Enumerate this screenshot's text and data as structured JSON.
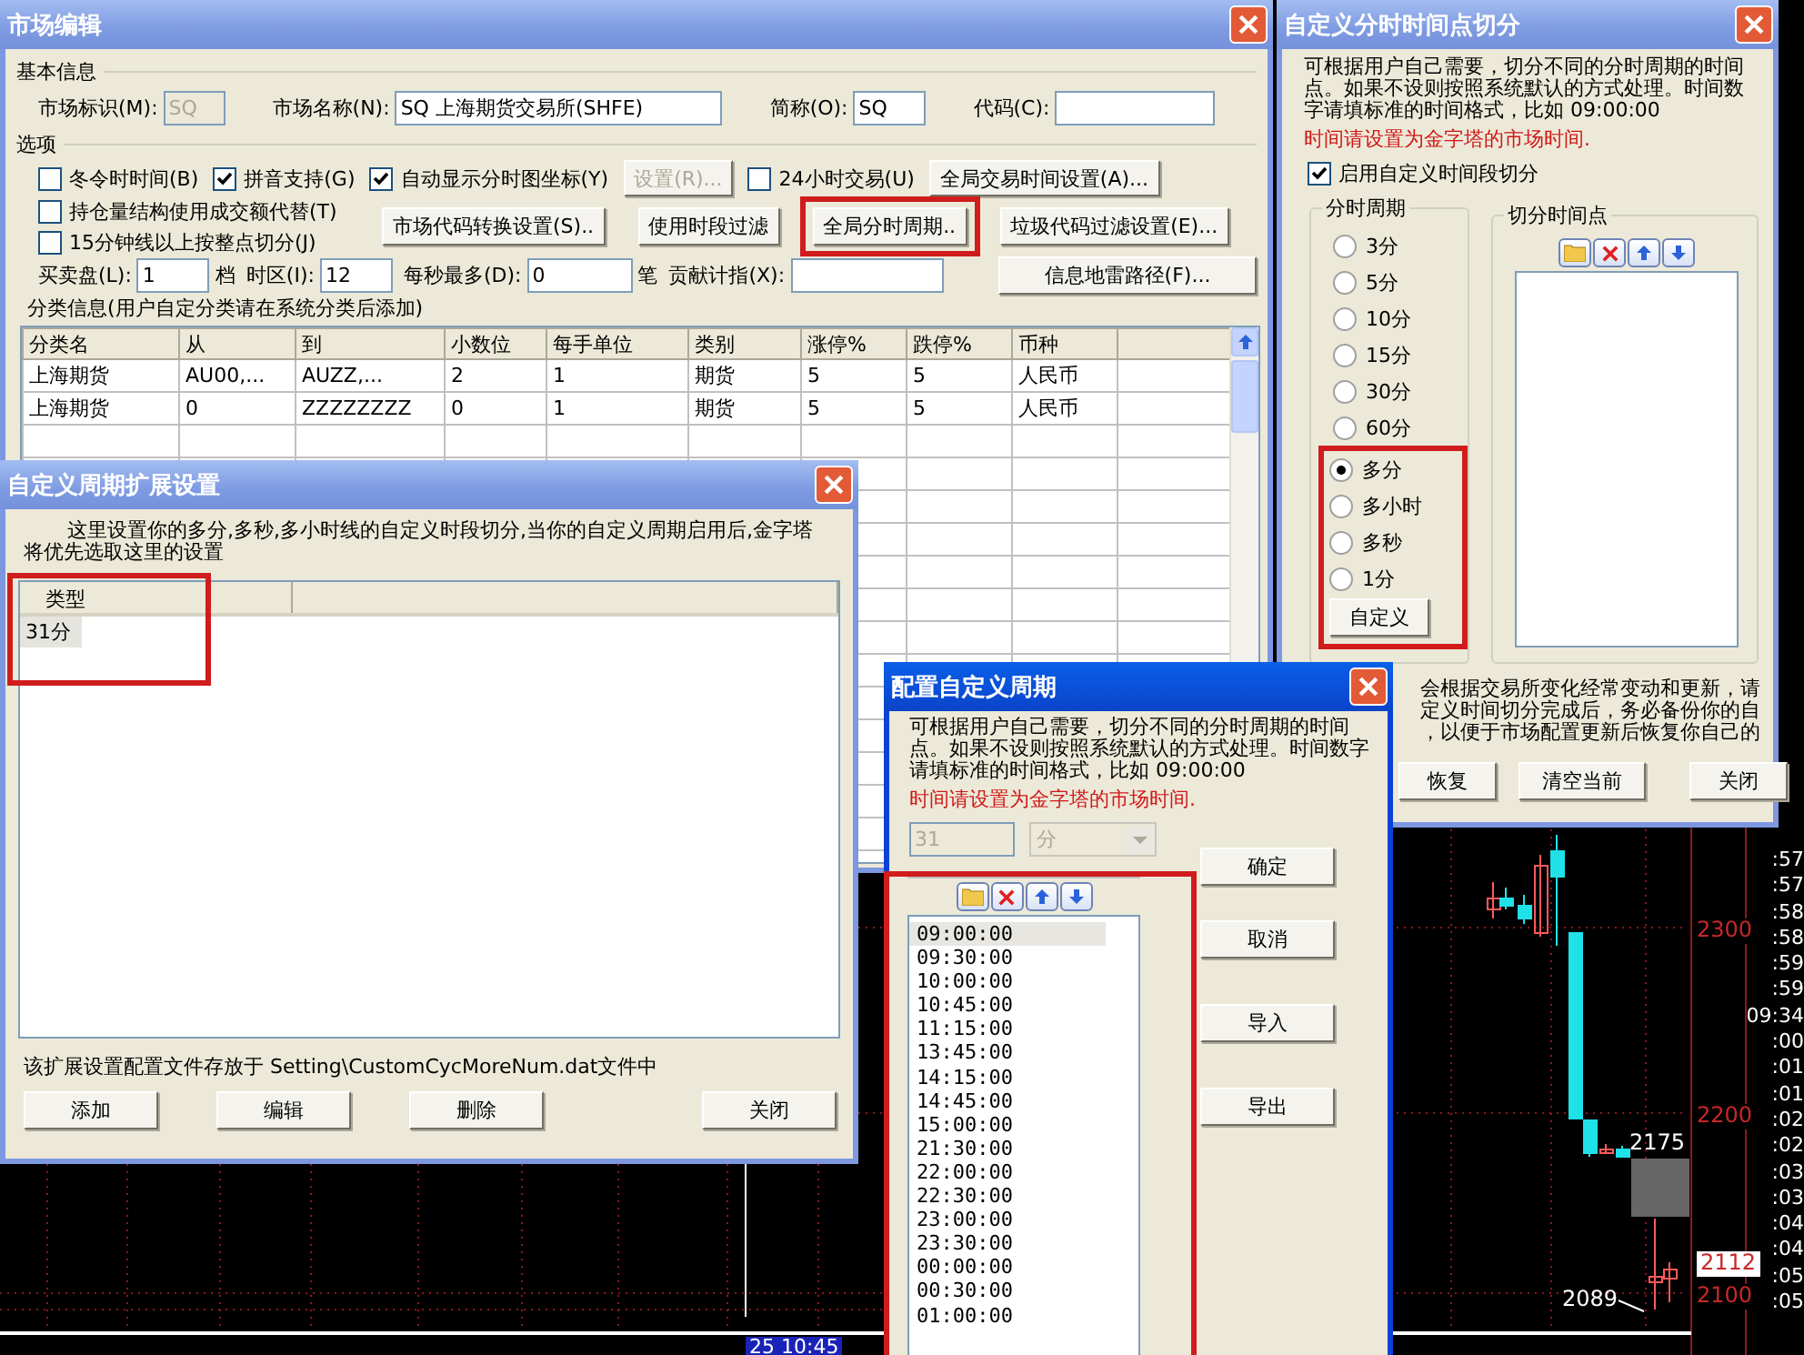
{
  "chart": {
    "price_labels": [
      "2300",
      "2200",
      "2100"
    ],
    "callouts": [
      "2175",
      "2089"
    ],
    "last_price": "2112",
    "time_labels": [
      ":57",
      ":57",
      ":58",
      ":58",
      ":59",
      ":59",
      "09:34",
      ":00",
      ":01",
      ":01",
      ":02",
      ":02",
      ":03",
      ":03",
      ":04",
      ":04",
      ":05",
      ":05"
    ],
    "cursor_time": "25 10:45"
  },
  "market_window": {
    "title": "市场编辑",
    "active": false,
    "basic_info": {
      "heading": "基本信息",
      "fields": [
        {
          "label": "市场标识(M):",
          "value": "SQ",
          "disabled": true
        },
        {
          "label": "市场名称(N):",
          "value": "SQ 上海期货交易所(SHFE)",
          "disabled": false
        },
        {
          "label": "简称(O):",
          "value": "SQ",
          "disabled": false
        },
        {
          "label": "代码(C):",
          "disabled": false
        }
      ]
    },
    "options": {
      "heading": "选项",
      "row_1": [
        {
          "kind": "checkbox",
          "label": "冬令时时间(B)",
          "checked": false
        },
        {
          "kind": "checkbox",
          "label": "拼音支持(G)",
          "checked": true
        },
        {
          "kind": "checkbox",
          "label": "自动显示分时图坐标(Y)",
          "checked": true
        },
        {
          "kind": "button",
          "label": "设置(R)...",
          "disabled": true
        },
        {
          "kind": "checkbox",
          "label": "24小时交易(U)",
          "checked": false
        },
        {
          "kind": "button",
          "label": "全局交易时间设置(A)...",
          "disabled": false
        }
      ],
      "side_checkboxes": [
        {
          "label": "持仓量结构使用成交额代替(T)",
          "checked": false
        },
        {
          "label": "15分钟线以上按整点切分(J)",
          "checked": false
        }
      ],
      "buttons": [
        {
          "label": "市场代码转换设置(S)..",
          "highlight": false
        },
        {
          "label": "使用时段过滤",
          "highlight": false
        },
        {
          "label": "全局分时周期..",
          "highlight": true
        },
        {
          "label": "垃圾代码过滤设置(E)...",
          "highlight": false
        }
      ],
      "fields": [
        {
          "label": "买卖盘(L):",
          "value": "1",
          "unit": "档"
        },
        {
          "label": "时区(I):",
          "value": "12"
        },
        {
          "label": "每秒最多(D):",
          "value": "0",
          "unit": "笔"
        },
        {
          "label": "贡献计指(X):"
        }
      ],
      "path_button": "信息地雷路径(F)..."
    },
    "table": {
      "caption": "分类信息(用户自定分类请在系统分类后添加)",
      "columns": [
        "分类名",
        "从",
        "到",
        "小数位",
        "每手单位",
        "类别",
        "涨停%",
        "跌停%",
        "币种"
      ],
      "rows": [
        [
          "上海期货",
          "AU00,...",
          "AUZZ,...",
          "2",
          "1",
          "期货",
          "5",
          "5",
          "人民币"
        ],
        [
          "上海期货",
          "0",
          "ZZZZZZZZ",
          "0",
          "1",
          "期货",
          "5",
          "5",
          "人民币"
        ]
      ]
    }
  },
  "extension_window": {
    "title": "自定义周期扩展设置",
    "active": false,
    "description": "这里设置你的多分,多秒,多小时线的自定义时段切分,当你的自定义周期启用后,金字塔将优先选取这里的设置",
    "list": {
      "column": "类型",
      "highlight": true,
      "items": [
        {
          "label": "31分",
          "selected": true
        }
      ]
    },
    "footer": "该扩展设置配置文件存放于 Setting\\CustomCycMoreNum.dat文件中",
    "buttons": [
      "添加",
      "编辑",
      "删除",
      "关闭"
    ]
  },
  "split_window": {
    "title": "自定义分时时间点切分",
    "active": false,
    "description": "可根据用户自己需要，切分不同的分时周期的时间点。如果不设则按照系统默认的方式处理。时间数字请填标准的时间格式，比如 09:00:00",
    "warning": "时间请设置为金字塔的市场时间.",
    "enable": {
      "label": "启用自定义时间段切分",
      "checked": true
    },
    "period_group": {
      "heading": "分时周期",
      "button_highlight": true,
      "options": [
        {
          "label": "3分",
          "selected": false,
          "highlight": false
        },
        {
          "label": "5分",
          "selected": false,
          "highlight": false
        },
        {
          "label": "10分",
          "selected": false,
          "highlight": false
        },
        {
          "label": "15分",
          "selected": false,
          "highlight": false
        },
        {
          "label": "30分",
          "selected": false,
          "highlight": false
        },
        {
          "label": "60分",
          "selected": false,
          "highlight": false
        },
        {
          "label": "多分",
          "selected": true,
          "highlight": true
        },
        {
          "label": "多小时",
          "selected": false,
          "highlight": true
        },
        {
          "label": "多秒",
          "selected": false,
          "highlight": true
        },
        {
          "label": "1分",
          "selected": false,
          "highlight": true
        }
      ],
      "button": "自定义"
    },
    "points_group": {
      "heading": "切分时间点"
    },
    "note_lines": [
      "会根据交易所变化经常变动和更新，请",
      "定义时间切分完成后，务必备份你的自",
      "，以便于市场配置更新后恢复你自己的"
    ],
    "buttons": [
      "恢复",
      "清空当前",
      "关闭"
    ]
  },
  "config_window": {
    "title": "配置自定义周期",
    "active": true,
    "description": "可根据用户自己需要，切分不同的分时周期的时间点。如果不设则按照系统默认的方式处理。时间数字请填标准的时间格式，比如 09:00:00",
    "warning": "时间请设置为金字塔的市场时间.",
    "count": "31",
    "unit": "分",
    "times": {
      "highlight": true,
      "items": [
        {
          "label": "09:00:00",
          "selected": true
        },
        {
          "label": "09:30:00",
          "selected": false
        },
        {
          "label": "10:00:00",
          "selected": false
        },
        {
          "label": "10:45:00",
          "selected": false
        },
        {
          "label": "11:15:00",
          "selected": false
        },
        {
          "label": "13:45:00",
          "selected": false
        },
        {
          "label": "14:15:00",
          "selected": false
        },
        {
          "label": "14:45:00",
          "selected": false
        },
        {
          "label": "15:00:00",
          "selected": false
        },
        {
          "label": "21:30:00",
          "selected": false
        },
        {
          "label": "22:00:00",
          "selected": false
        },
        {
          "label": "22:30:00",
          "selected": false
        },
        {
          "label": "23:00:00",
          "selected": false
        },
        {
          "label": "23:30:00",
          "selected": false
        },
        {
          "label": "00:00:00",
          "selected": false
        },
        {
          "label": "00:30:00",
          "selected": false
        },
        {
          "label": "01:00:00",
          "selected": false
        }
      ]
    },
    "buttons": [
      "确定",
      "取消",
      "导入",
      "导出"
    ]
  }
}
